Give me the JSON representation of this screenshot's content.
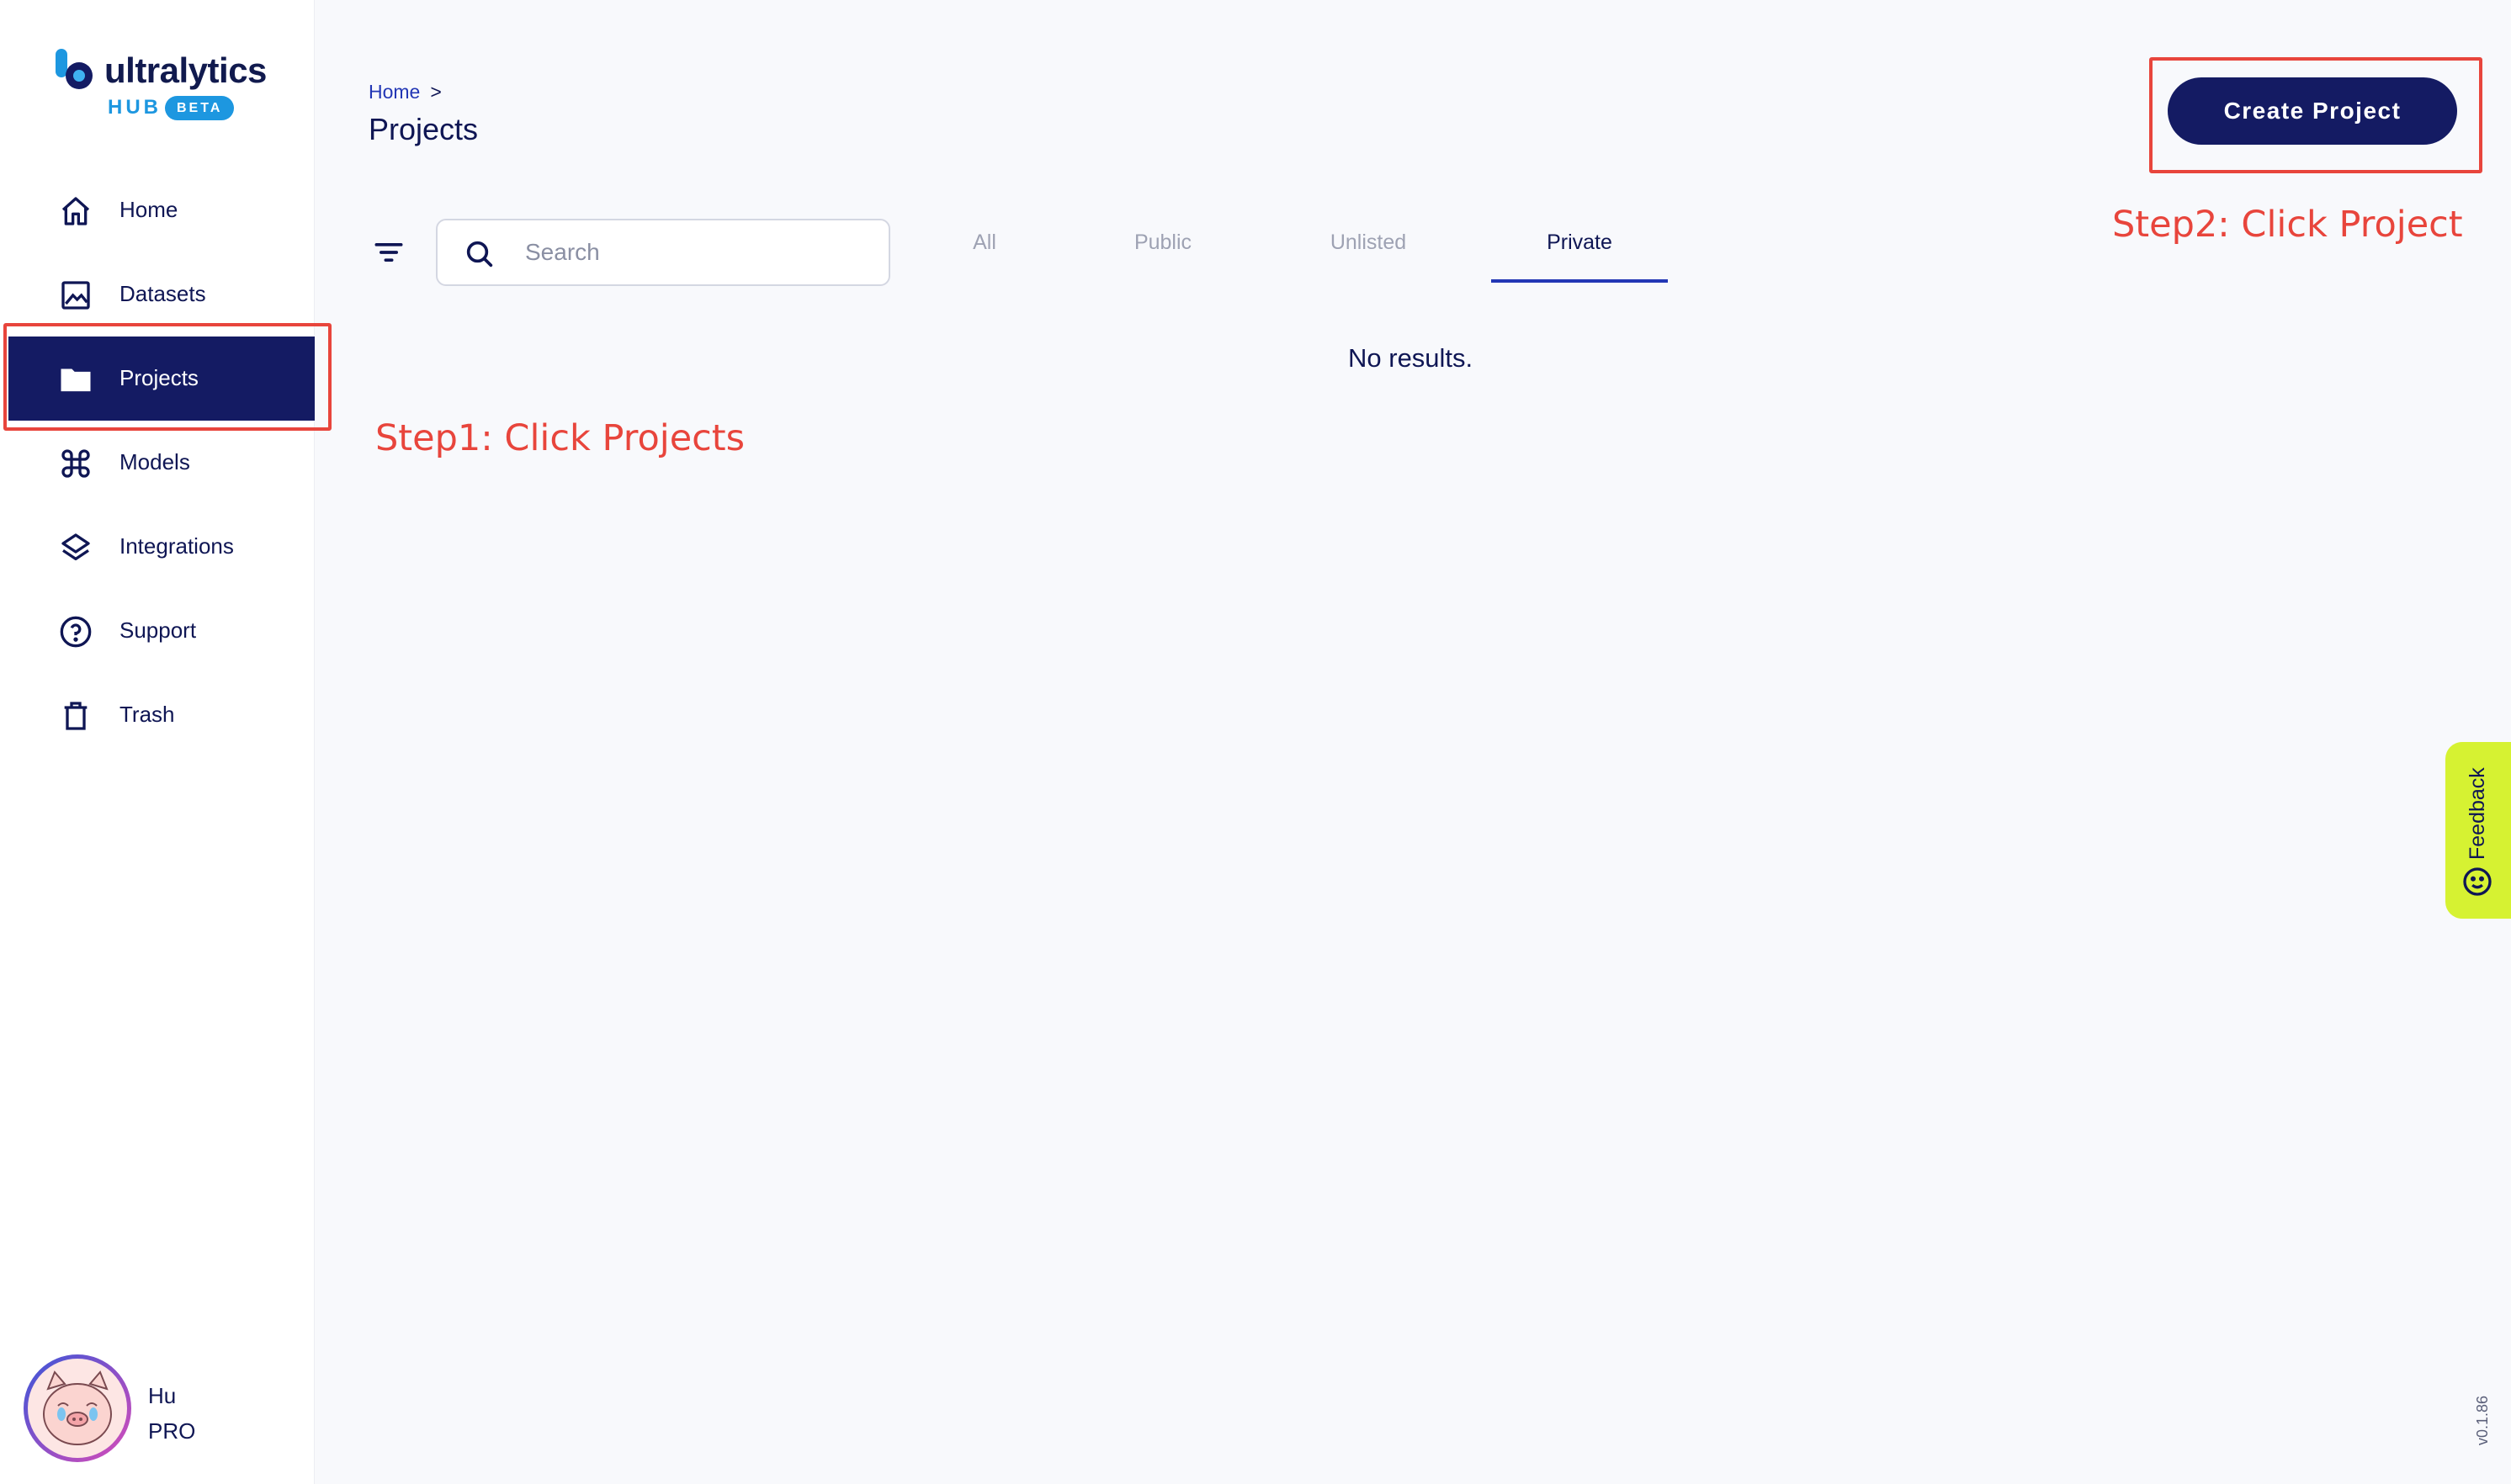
{
  "brand": {
    "name": "ultralytics",
    "hub": "HUB",
    "badge": "BETA"
  },
  "sidebar": {
    "items": [
      {
        "label": "Home",
        "icon": "home-icon",
        "active": false
      },
      {
        "label": "Datasets",
        "icon": "image-icon",
        "active": false
      },
      {
        "label": "Projects",
        "icon": "folder-icon",
        "active": true
      },
      {
        "label": "Models",
        "icon": "command-icon",
        "active": false
      },
      {
        "label": "Integrations",
        "icon": "layers-icon",
        "active": false
      },
      {
        "label": "Support",
        "icon": "help-circle-icon",
        "active": false
      },
      {
        "label": "Trash",
        "icon": "trash-icon",
        "active": false
      }
    ]
  },
  "user": {
    "name": "Hu",
    "plan": "PRO"
  },
  "header": {
    "breadcrumb": {
      "home": "Home",
      "separator": ">"
    },
    "title": "Projects",
    "create_label": "Create Project"
  },
  "search": {
    "placeholder": "Search",
    "value": ""
  },
  "tabs": [
    {
      "label": "All",
      "active": false
    },
    {
      "label": "Public",
      "active": false
    },
    {
      "label": "Unlisted",
      "active": false
    },
    {
      "label": "Private",
      "active": true
    }
  ],
  "results": {
    "empty_message": "No results."
  },
  "annotations": {
    "step1": "Step1: Click Projects",
    "step2": "Step2: Click Project"
  },
  "feedback": {
    "label": "Feedback"
  },
  "version": "v0.1.86",
  "colors": {
    "primary": "#141b63",
    "link": "#2337b5",
    "annotation": "#e8453c",
    "feedback_bg": "#d6f232",
    "brand_blue": "#1d97e0"
  }
}
